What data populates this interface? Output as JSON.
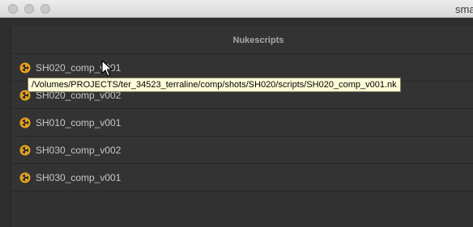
{
  "window": {
    "title": "sma"
  },
  "list": {
    "header": "Nukescripts",
    "icon": "nuke-script-icon",
    "items": [
      {
        "label": "SH020_comp_v001"
      },
      {
        "label": "SH020_comp_v002"
      },
      {
        "label": "SH010_comp_v001"
      },
      {
        "label": "SH030_comp_v002"
      },
      {
        "label": "SH030_comp_v001"
      }
    ]
  },
  "tooltip": {
    "text": "/Volumes/PROJECTS/ter_34523_terraline/comp/shots/SH020/scripts/SH020_comp_v001.nk"
  },
  "colors": {
    "background": "#2b2b2b",
    "row": "#333333",
    "text": "#c7c7c7",
    "icon": "#e8a21c",
    "tooltip_bg": "#fffed8"
  }
}
